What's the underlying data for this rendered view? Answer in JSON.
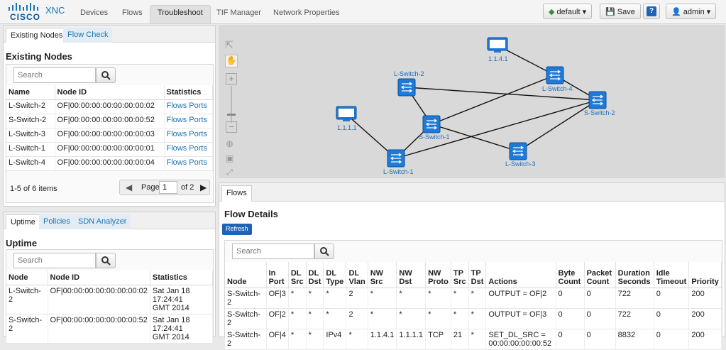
{
  "brand": {
    "name": "CISCO",
    "product": "XNC"
  },
  "nav": {
    "tabs": [
      "Devices",
      "Flows",
      "Troubleshoot",
      "TIF Manager",
      "Network Properties"
    ],
    "active": "Troubleshoot"
  },
  "toolbar": {
    "slice": "default",
    "save": "Save",
    "help": "?",
    "user": "admin"
  },
  "existing_nodes": {
    "tabs": [
      "Existing Nodes",
      "Flow Check"
    ],
    "title": "Existing Nodes",
    "search_placeholder": "Search",
    "columns": [
      "Name",
      "Node ID",
      "Statistics"
    ],
    "rows": [
      {
        "name": "L-Switch-2",
        "node_id": "OF|00:00:00:00:00:00:00:02",
        "flows": "Flows",
        "ports": "Ports"
      },
      {
        "name": "S-Switch-2",
        "node_id": "OF|00:00:00:00:00:00:00:52",
        "flows": "Flows",
        "ports": "Ports"
      },
      {
        "name": "L-Switch-3",
        "node_id": "OF|00:00:00:00:00:00:00:03",
        "flows": "Flows",
        "ports": "Ports"
      },
      {
        "name": "L-Switch-1",
        "node_id": "OF|00:00:00:00:00:00:00:01",
        "flows": "Flows",
        "ports": "Ports"
      },
      {
        "name": "L-Switch-4",
        "node_id": "OF|00:00:00:00:00:00:00:04",
        "flows": "Flows",
        "ports": "Ports"
      }
    ],
    "footer": {
      "items": "1-5 of 6 items",
      "page_label": "Page",
      "page": "1",
      "of": "of 2"
    }
  },
  "uptime": {
    "tabs": [
      "Uptime",
      "Policies",
      "SDN Analyzer"
    ],
    "title": "Uptime",
    "search_placeholder": "Search",
    "columns": [
      "Node",
      "Node ID",
      "Statistics"
    ],
    "rows": [
      {
        "node": "L-Switch-2",
        "node_id": "OF|00:00:00:00:00:00:00:02",
        "stat1": "Sat Jan 18 17:24:41",
        "stat2": "GMT 2014"
      },
      {
        "node": "S-Switch-2",
        "node_id": "OF|00:00:00:00:00:00:00:52",
        "stat1": "Sat Jan 18 17:24:41",
        "stat2": "GMT 2014"
      }
    ]
  },
  "topology": {
    "nodes": [
      "1.1.4.1",
      "L-Switch-2",
      "L-Switch-4",
      "S-Switch-2",
      "1.1.1.1",
      "S-Switch-1",
      "L-Switch-3",
      "L-Switch-1"
    ]
  },
  "flows": {
    "tab": "Flows",
    "title": "Flow Details",
    "refresh": "Refresh",
    "search_placeholder": "Search",
    "columns": [
      [
        "Node",
        ""
      ],
      [
        "In",
        "Port"
      ],
      [
        "DL",
        "Src"
      ],
      [
        "DL",
        "Dst"
      ],
      [
        "DL",
        "Type"
      ],
      [
        "DL",
        "Vlan"
      ],
      [
        "NW",
        "Src"
      ],
      [
        "NW",
        "Dst"
      ],
      [
        "NW",
        "Proto"
      ],
      [
        "TP",
        "Src"
      ],
      [
        "TP",
        "Dst"
      ],
      [
        "Actions",
        ""
      ],
      [
        "Byte",
        "Count"
      ],
      [
        "Packet",
        "Count"
      ],
      [
        "Duration",
        "Seconds"
      ],
      [
        "Idle",
        "Timeout"
      ],
      [
        "Priority",
        ""
      ]
    ],
    "rows": [
      [
        "S-Switch-2",
        "OF|3",
        "*",
        "*",
        "*",
        "2",
        "*",
        "*",
        "*",
        "*",
        "*",
        "OUTPUT = OF|2",
        "0",
        "0",
        "722",
        "0",
        "200"
      ],
      [
        "S-Switch-2",
        "OF|2",
        "*",
        "*",
        "*",
        "2",
        "*",
        "*",
        "*",
        "*",
        "*",
        "OUTPUT = OF|3",
        "0",
        "0",
        "722",
        "0",
        "200"
      ],
      [
        "S-Switch-2",
        "OF|4",
        "*",
        "*",
        "IPv4",
        "*",
        "1.1.4.1",
        "1.1.1.1",
        "TCP",
        "21",
        "*",
        "SET_DL_SRC = 00:00:00:00:00:52",
        "0",
        "0",
        "8832",
        "0",
        "200"
      ]
    ]
  }
}
